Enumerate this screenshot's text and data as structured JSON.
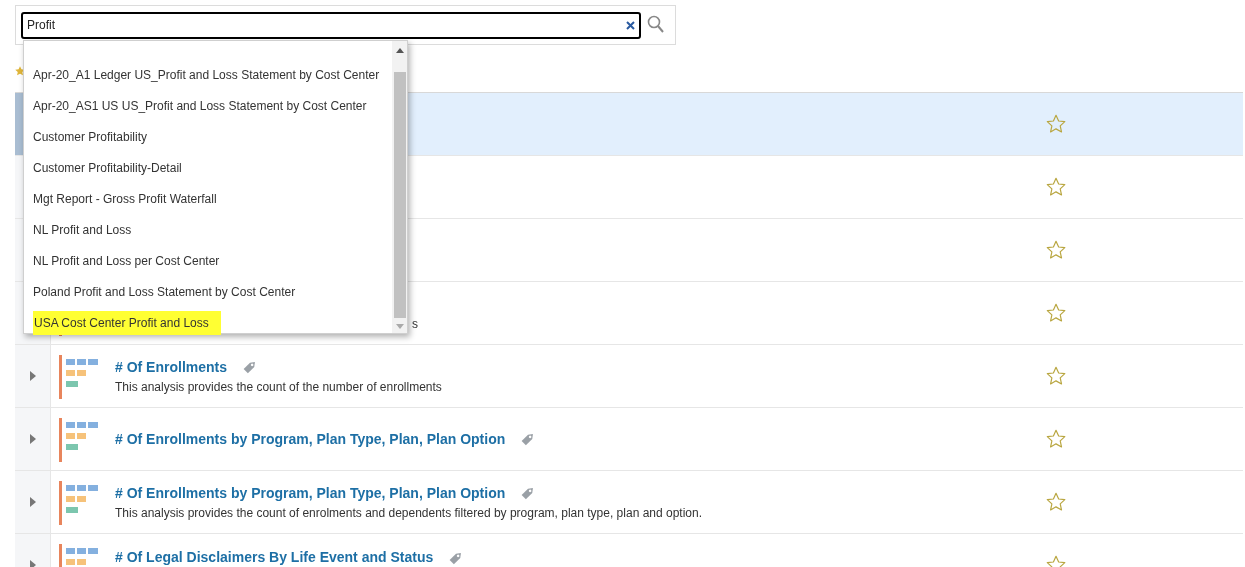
{
  "search": {
    "value": "Profit"
  },
  "suggestions": [
    {
      "label": "Apr-20_A1 Ledger US_Profit and Loss Statement by Cost Center",
      "highlighted": false
    },
    {
      "label": "Apr-20_AS1 US US_Profit and Loss Statement by Cost Center",
      "highlighted": false
    },
    {
      "label": "Customer Profitability",
      "highlighted": false
    },
    {
      "label": "Customer Profitability-Detail",
      "highlighted": false
    },
    {
      "label": "Mgt Report - Gross Profit Waterfall",
      "highlighted": false
    },
    {
      "label": "NL Profit and Loss",
      "highlighted": false
    },
    {
      "label": "NL Profit and Loss per Cost Center",
      "highlighted": false
    },
    {
      "label": "Poland Profit and Loss Statement by Cost Center",
      "highlighted": false
    },
    {
      "label": "USA Cost Center Profit and Loss",
      "highlighted": true
    }
  ],
  "results": [
    {
      "selected": true
    },
    {
      "selected": false
    },
    {
      "selected": false
    },
    {
      "selected": false,
      "description": "s"
    },
    {
      "selected": false,
      "title": "# Of Enrollments",
      "description": "This analysis provides the count of the number of enrollments"
    },
    {
      "selected": false,
      "title": "# Of Enrollments by Program, Plan Type, Plan, Plan Option"
    },
    {
      "selected": false,
      "title": "# Of Enrollments by Program, Plan Type, Plan, Plan Option",
      "description": "This analysis provides the count of enrolments and dependents filtered by program, plan type, plan and option."
    },
    {
      "selected": false,
      "title": "# Of Legal Disclaimers By Life Event and Status"
    }
  ]
}
